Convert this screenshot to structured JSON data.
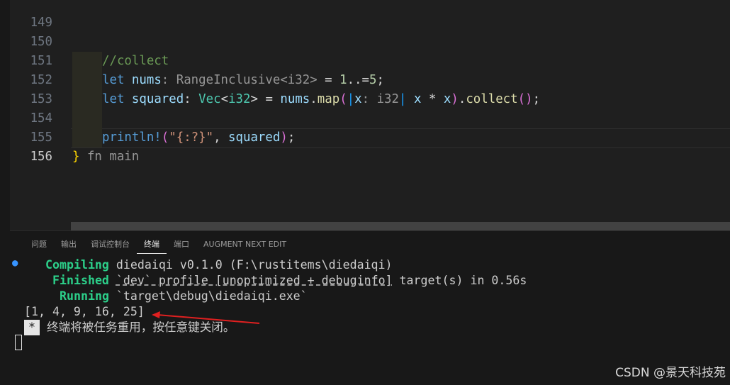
{
  "editor": {
    "lines": [
      {
        "num": "149"
      },
      {
        "num": "150",
        "comment": "//collect"
      },
      {
        "num": "151",
        "let": "let",
        "name": "nums",
        "hint": ": RangeInclusive<i32>",
        "eq": " = ",
        "n1": "1",
        "range": "..=",
        "n2": "5",
        "semi": ";"
      },
      {
        "num": "152",
        "let": "let",
        "name": "squared",
        "colon": ": ",
        "vec": "Vec",
        "lt": "<",
        "i32": "i32",
        "gt": ">",
        "eq": " = ",
        "recv": "nums",
        "dot": ".",
        "map": "map",
        "p1": "(",
        "pipe1": "|",
        "x": "x",
        "hint": ": i32",
        "pipe2": "|",
        "body_x1": " x",
        "mul": " * ",
        "body_x2": "x",
        "p2": ")",
        "dot2": ".",
        "collect": "collect",
        "p3": "()",
        "semi": ";"
      },
      {
        "num": "153"
      },
      {
        "num": "154",
        "macro": "println!",
        "p1": "(",
        "str": "\"{:?}\"",
        "comma": ", ",
        "arg": "squared",
        "p2": ")",
        "semi": ";"
      },
      {
        "num": "155",
        "brace": "}",
        "hint": " fn main"
      },
      {
        "num": "156"
      }
    ]
  },
  "panel": {
    "tabs": [
      {
        "label": "问题"
      },
      {
        "label": "输出"
      },
      {
        "label": "调试控制台"
      },
      {
        "label": "终端"
      },
      {
        "label": "端口"
      },
      {
        "label": "AUGMENT NEXT EDIT"
      }
    ],
    "active_tab": "终端"
  },
  "terminal": {
    "dot": "●",
    "compiling_label": "Compiling",
    "compiling_text": " diedaiqi v0.1.0 (F:\\rustitems\\diedaiqi)",
    "finished_label": "Finished",
    "finished_profile": "`dev` profile [unoptimized + debuginfo]",
    "finished_text": " target(s) in 0.56s",
    "running_label": "Running",
    "running_text": " `target\\debug\\diedaiqi.exe`",
    "output": "[1, 4, 9, 16, 25]",
    "badge": "*",
    "close_msg": " 终端将被任务重用，按任意键关闭。"
  },
  "watermark": "CSDN @景天科技苑",
  "colors": {
    "annotation_arrow": "#e02020",
    "accent": "#3794ff",
    "cargo_green": "#2cd08a"
  }
}
